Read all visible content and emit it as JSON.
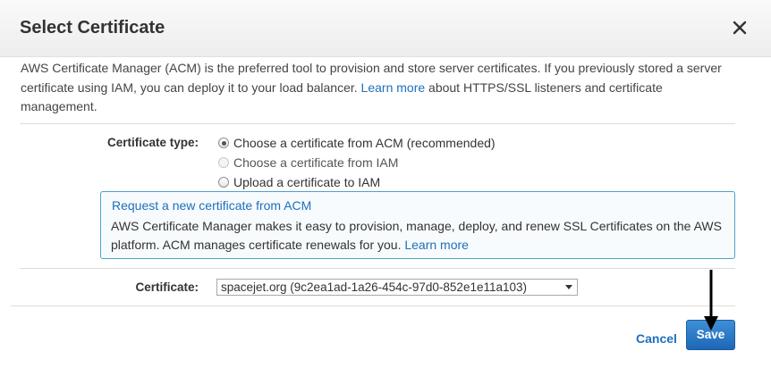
{
  "dialog": {
    "title": "Select Certificate"
  },
  "intro": {
    "text": "AWS Certificate Manager (ACM) is the preferred tool to provision and store server certificates. If you previously stored a server certificate using IAM, you can deploy it to your load balancer.",
    "link": "Learn more",
    "suffix": "about HTTPS/SSL listeners and certificate management."
  },
  "certificate_type": {
    "label": "Certificate type:",
    "options": [
      {
        "label": "Choose a certificate from ACM (recommended)",
        "state": "selected"
      },
      {
        "label": "Choose a certificate from IAM",
        "state": "disabled"
      },
      {
        "label": "Upload a certificate to IAM",
        "state": "unselected"
      }
    ]
  },
  "info": {
    "title": "Request a new certificate from ACM",
    "body": "AWS Certificate Manager makes it easy to provision, manage, deploy, and renew SSL Certificates on the AWS platform. ACM manages certificate renewals for you.",
    "link": "Learn more"
  },
  "certificate": {
    "label": "Certificate:",
    "selected": "spacejet.org (9c2ea1ad-1a26-454c-97d0-852e1e11a103)"
  },
  "footer": {
    "cancel_label": "Cancel",
    "save_label": "Save"
  },
  "colors": {
    "link": "#1e6fbb",
    "primary_button": "#1d67b6",
    "info_border": "#4aa3c9"
  }
}
